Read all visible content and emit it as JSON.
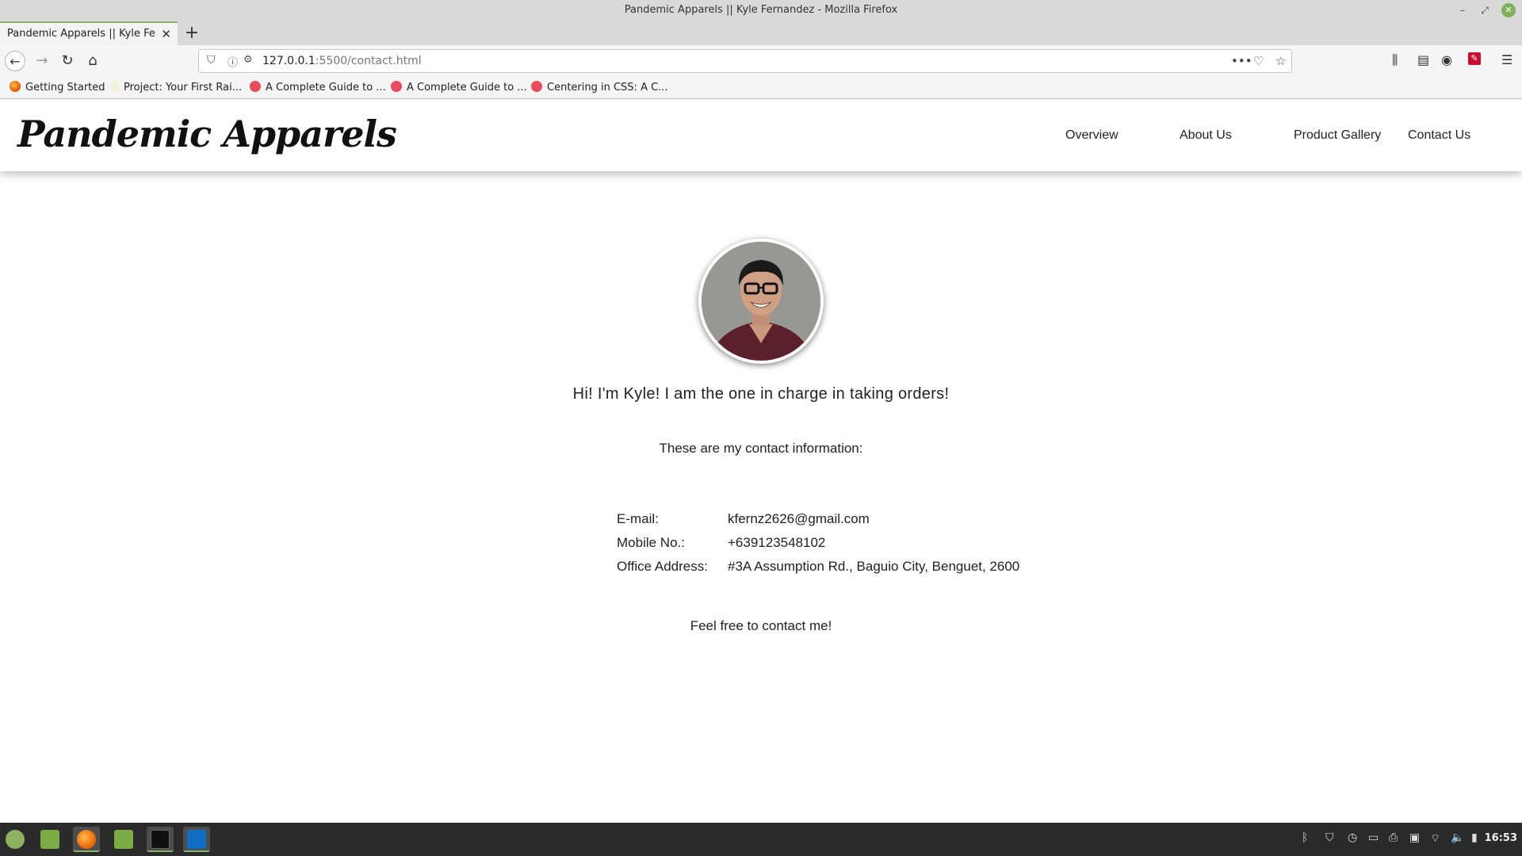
{
  "window": {
    "title": "Pandemic Apparels || Kyle Fernandez - Mozilla Firefox",
    "controls": [
      "minimize",
      "maximize",
      "close"
    ]
  },
  "tab": {
    "title": "Pandemic Apparels || Kyle Fernandez",
    "close_glyph": "✕",
    "new_tab_glyph": "+"
  },
  "nav": {
    "url_host": "127.0.0.1",
    "url_rest": ":5500/contact.html"
  },
  "bookmarks": [
    {
      "label": "Getting Started",
      "icon": "firefox-icon"
    },
    {
      "label": "Project: Your First Rai...",
      "icon": "rails-icon"
    },
    {
      "label": "A Complete Guide to ...",
      "icon": "css-tricks-icon"
    },
    {
      "label": "A Complete Guide to ...",
      "icon": "css-tricks-icon"
    },
    {
      "label": "Centering in CSS: A C...",
      "icon": "css-tricks-icon"
    }
  ],
  "site": {
    "logo": "Pandemic Apparels",
    "menu": [
      "Overview",
      "About Us",
      "Product Gallery",
      "Contact Us"
    ]
  },
  "content": {
    "greeting": "Hi! I'm Kyle! I am the one in charge in taking orders!",
    "intro": "These are my contact information:",
    "contacts": [
      {
        "label": "E-mail:",
        "value": "kfernz2626@gmail.com"
      },
      {
        "label": "Mobile No.:",
        "value": "+639123548102"
      },
      {
        "label": "Office Address:",
        "value": "#3A Assumption Rd., Baguio City, Benguet, 2600"
      }
    ],
    "outro": "Feel free to contact me!"
  },
  "taskbar": {
    "apps": [
      "mint-menu-icon",
      "show-desktop-icon",
      "firefox-icon",
      "files-icon",
      "terminal-icon",
      "vscode-icon"
    ],
    "clock": "16:53"
  },
  "colors": {
    "accent": "#8cb160",
    "taskbar": "#2b2b2b"
  }
}
